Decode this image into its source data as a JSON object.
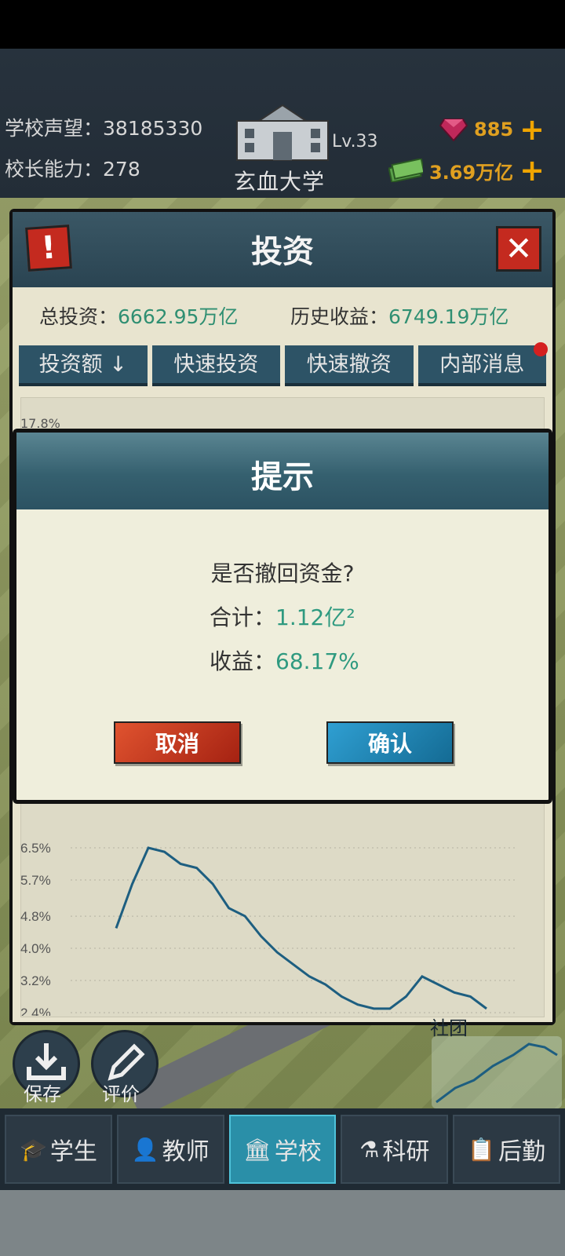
{
  "header": {
    "reputation_label": "学校声望：",
    "reputation_value": "38185330",
    "principal_label": "校长能力：",
    "principal_value": "278",
    "school_level": "Lv.33",
    "school_name": "玄血大学",
    "gems": "885",
    "money": "3.69万亿"
  },
  "invest_panel": {
    "title": "投资",
    "total_label": "总投资：",
    "total_value": "6662.95万亿",
    "history_label": "历史收益：",
    "history_value": "6749.19万亿",
    "tabs": [
      "投资额 ↓",
      "快速投资",
      "快速撤资",
      "内部消息"
    ],
    "top_label": "17.8%"
  },
  "dialog": {
    "title": "提示",
    "question": "是否撤回资金?",
    "sum_label": "合计：",
    "sum_value": "1.12亿²",
    "profit_label": "收益：",
    "profit_value": "68.17%",
    "cancel": "取消",
    "confirm": "确认"
  },
  "quick_buttons": {
    "save": "保存",
    "rate": "评价",
    "community": "社团"
  },
  "nav": [
    "学生",
    "教师",
    "学校",
    "科研",
    "后勤"
  ],
  "colors": {
    "accent_green": "#2f9a80",
    "cancel_red": "#c42a1f",
    "confirm_blue": "#1f86b4"
  },
  "chart_data": {
    "type": "line",
    "title": "",
    "xlabel": "",
    "ylabel": "",
    "y_ticks": [
      "6.5%",
      "5.7%",
      "4.8%",
      "4.0%",
      "3.2%",
      "2.4%"
    ],
    "ylim": [
      2.4,
      6.5
    ],
    "series": [
      {
        "values": [
          4.5,
          5.6,
          6.5,
          6.4,
          6.1,
          6.0,
          5.6,
          5.0,
          4.8,
          4.3,
          3.9,
          3.6,
          3.3,
          3.1,
          2.8,
          2.6,
          2.5,
          2.5,
          2.8,
          3.3,
          3.1,
          2.9,
          2.8,
          2.5
        ]
      }
    ]
  }
}
